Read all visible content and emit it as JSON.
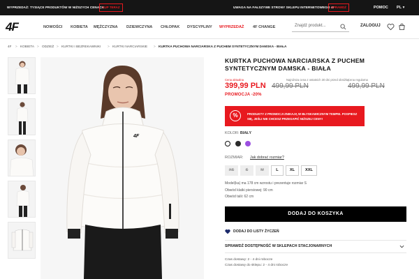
{
  "topbar": {
    "sale_text": "WYPRZEDAŻ: TYSIĄCE PRODUKTÓW W NIŻSZYCH CENACH",
    "buy_now": "KUP TERAZ",
    "fake_warning": "UWAGA NA FAŁSZYWE STRONY SKLEPU INTERNETOWEGO 4F",
    "check": "SPRAWDŹ",
    "help": "POMOC",
    "lang": "PL"
  },
  "header": {
    "logo": "4F",
    "nav": [
      "NOWOŚCI",
      "KOBIETA",
      "MĘŻCZYZNA",
      "DZIEWCZYNA",
      "CHŁOPAK",
      "DYSCYPLINY",
      "WYPRZEDAŻ",
      "4F CHANGE"
    ],
    "search_placeholder": "Znajdź produkt...",
    "login": "ZALOGUJ"
  },
  "breadcrumb": [
    "4F",
    "KOBIETA",
    "ODZIEŻ",
    "KURTKI I BEZREKAWNIKI",
    "KURTKI NARCIARSKIE",
    "KURTKA PUCHOWA NARCIARSKA Z PUCHEM SYNTETYCZNYM DAMSKA - BIAŁA"
  ],
  "product": {
    "title": "KURTKA PUCHOWA NARCIARSKA Z PUCHEM SYNTETYCZNYM DAMSKA - BIAŁA",
    "current_label": "Cena aktualna",
    "lowest_label": "Najniższa cena z ostatnich 30 dni przed obniżką",
    "regular_label": "Cena regularna",
    "price_now": "399,99 PLN",
    "price_lowest": "499,99 PLN",
    "price_regular": "499,99 PLN",
    "promo": "PROMOCJA -20%",
    "promo_box_line1": "PRODUKTY Z PROMOCJI ZNIKAJĄ W BŁYSKAWICZNYM TEMPIE. POSPIESZ",
    "promo_box_line2": "SIĘ, JEŚLI NIE CHCESZ PRZEGAPIĆ NIŻSZEJ CENY!",
    "promo_icon": "%",
    "color_label": "KOLOR:",
    "color_value": "BIAŁY",
    "swatches": [
      "#ffffff",
      "#2b2b2b",
      "#9b4fe0"
    ],
    "size_label": "ROZMIAR:",
    "size_guide": "Jak dobrać rozmiar?",
    "sizes": [
      "XS",
      "S",
      "M",
      "L",
      "XL",
      "XXL"
    ],
    "model_lines": [
      "Model(ka) ma 178 cm wzrostu i prezentuje rozmiar S",
      "Obwód klatki piersiowej: 90 cm",
      "Obwód talii: 62 cm"
    ],
    "add_to_cart": "DODAJ DO KOSZYKA",
    "wishlist": "DODAJ DO LISTY ŻYCZEŃ",
    "availability": "SPRAWDŹ DOSTĘPNOŚĆ W SKLEPACH STACJONARNYCH",
    "delivery_lines": [
      "Czas dostawy: 2 - 4 dni robocze",
      "Czas dostawy do sklepu: 2 - 4 dni robocze"
    ]
  },
  "colors": {
    "accent": "#e8191f",
    "dark": "#151515"
  }
}
